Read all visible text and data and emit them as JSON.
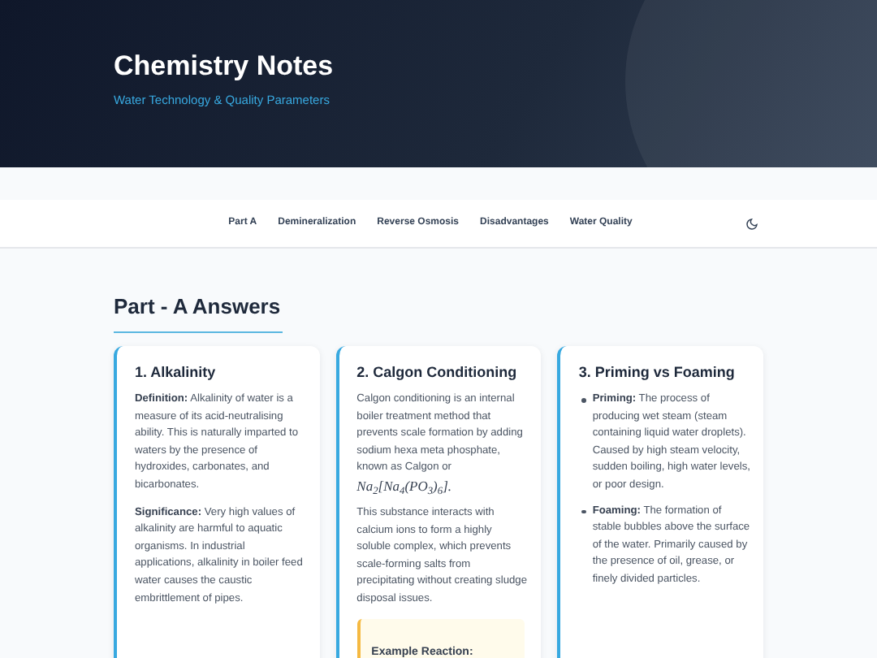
{
  "header": {
    "title": "Chemistry Notes",
    "subtitle": "Water Technology & Quality Parameters"
  },
  "nav": {
    "items": [
      {
        "label": "Part A"
      },
      {
        "label": "Demineralization"
      },
      {
        "label": "Reverse Osmosis"
      },
      {
        "label": "Disadvantages"
      },
      {
        "label": "Water Quality"
      }
    ]
  },
  "section": {
    "title": "Part - A Answers"
  },
  "cards": [
    {
      "kind": "paragraphs",
      "title": "1. Alkalinity",
      "paragraphs": [
        {
          "text": "**Definition:** Alkalinity of water is a measure of its acid-neutralising ability. This is naturally imparted to waters by the presence of hydroxides, carbonates, and bicarbonates."
        },
        {
          "text": "**Significance:** Very high values of alkalinity are harmful to aquatic organisms. In industrial applications, alkalinity in boiler feed water causes the caustic embrittlement of pipes."
        }
      ]
    },
    {
      "kind": "paragraphs",
      "title": "2. Calgon Conditioning",
      "paragraphs": [
        {
          "text": "Calgon conditioning is an internal boiler treatment method that prevents scale formation by adding sodium hexa meta phosphate, known as Calgon or",
          "formula": "Na$_{2}$[Na$_{4}$(PO$_{3}$)$_{6}$]",
          "after": "."
        },
        {
          "text": "This substance interacts with calcium ions to form a highly soluble complex, which prevents scale-forming salts from precipitating without creating sludge disposal issues."
        }
      ],
      "callout": "Example Reaction:"
    },
    {
      "kind": "bullets",
      "title": "3. Priming vs Foaming",
      "bullets": [
        {
          "text": "**Priming:** The process of producing wet steam (steam containing liquid water droplets). Caused by high steam velocity, sudden boiling, high water levels, or poor design."
        },
        {
          "text": "**Foaming:** The formation of stable bubbles above the surface of the water. Primarily caused by the presence of oil, grease, or finely divided particles."
        }
      ]
    }
  ]
}
